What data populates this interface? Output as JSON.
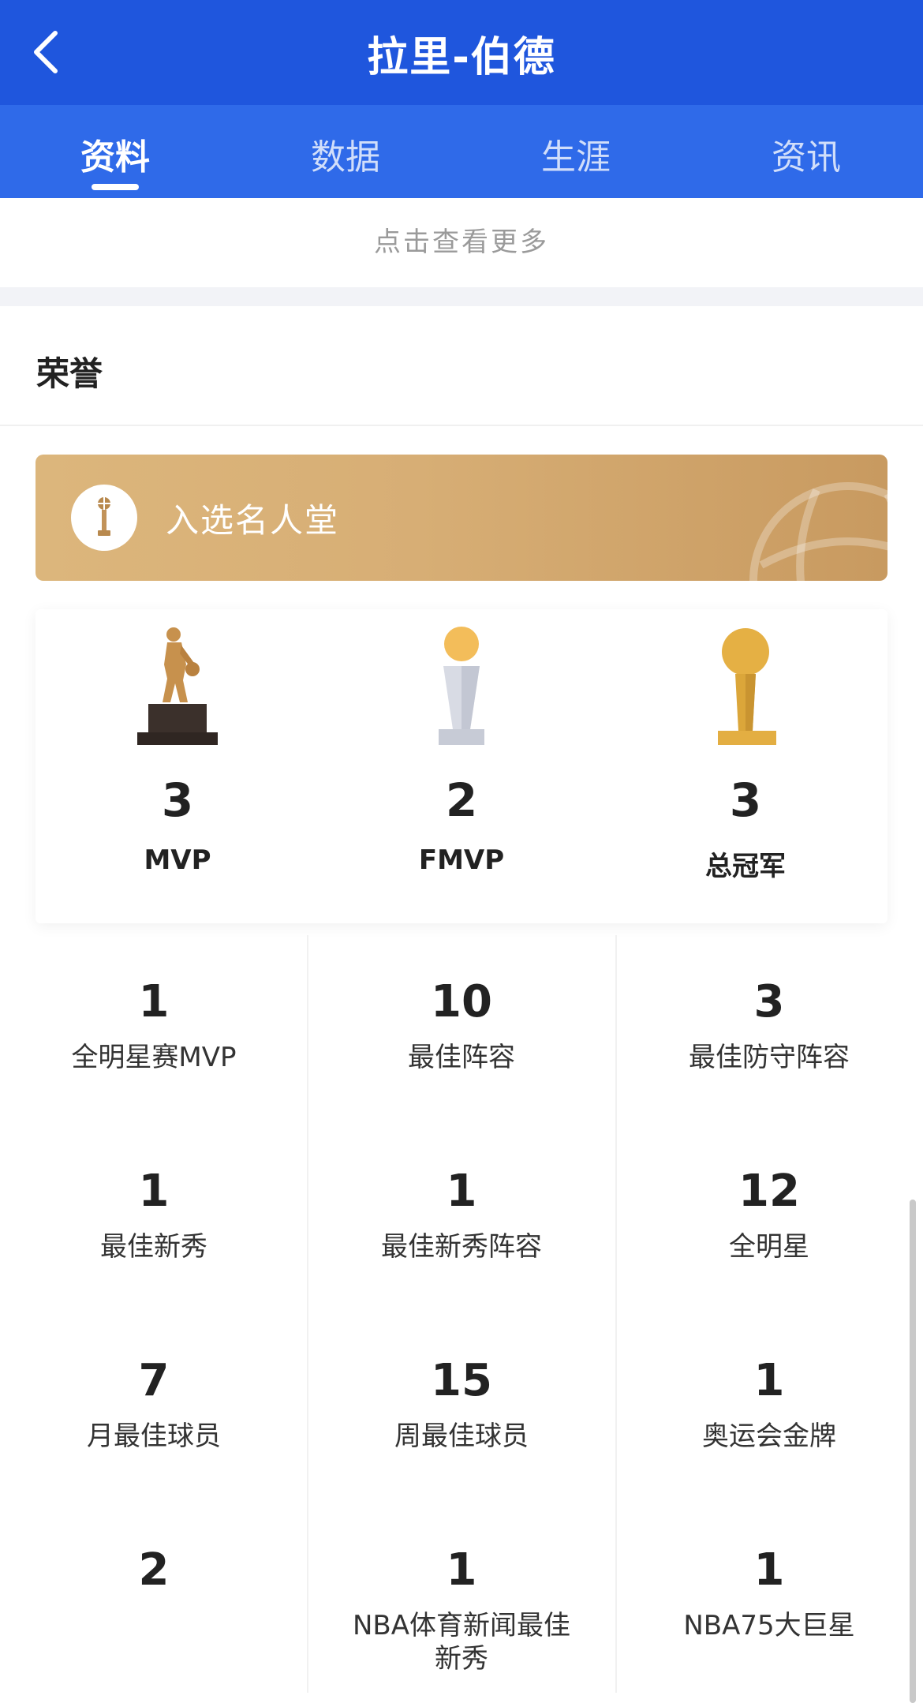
{
  "header": {
    "title": "拉里-伯德"
  },
  "tabs": [
    {
      "label": "资料",
      "active": true
    },
    {
      "label": "数据",
      "active": false
    },
    {
      "label": "生涯",
      "active": false
    },
    {
      "label": "资讯",
      "active": false
    }
  ],
  "more_link": "点击查看更多",
  "honors": {
    "section_title": "荣誉",
    "hall_of_fame": "入选名人堂",
    "major": [
      {
        "count": "3",
        "label": "MVP",
        "icon": "mvp-trophy-icon"
      },
      {
        "count": "2",
        "label": "FMVP",
        "icon": "fmvp-trophy-icon"
      },
      {
        "count": "3",
        "label": "总冠军",
        "icon": "championship-trophy-icon"
      }
    ],
    "grid": [
      {
        "count": "1",
        "label": "全明星赛MVP"
      },
      {
        "count": "10",
        "label": "最佳阵容"
      },
      {
        "count": "3",
        "label": "最佳防守阵容"
      },
      {
        "count": "1",
        "label": "最佳新秀"
      },
      {
        "count": "1",
        "label": "最佳新秀阵容"
      },
      {
        "count": "12",
        "label": "全明星"
      },
      {
        "count": "7",
        "label": "月最佳球员"
      },
      {
        "count": "15",
        "label": "周最佳球员"
      },
      {
        "count": "1",
        "label": "奥运会金牌"
      },
      {
        "count": "2",
        "label": ""
      },
      {
        "count": "1",
        "label": "NBA体育新闻最佳新秀"
      },
      {
        "count": "1",
        "label": "NBA75大巨星"
      }
    ]
  },
  "colors": {
    "header_bg": "#1f56dd",
    "tabs_bg": "#2f6ae9",
    "hof_gold": "#d7ae75"
  }
}
